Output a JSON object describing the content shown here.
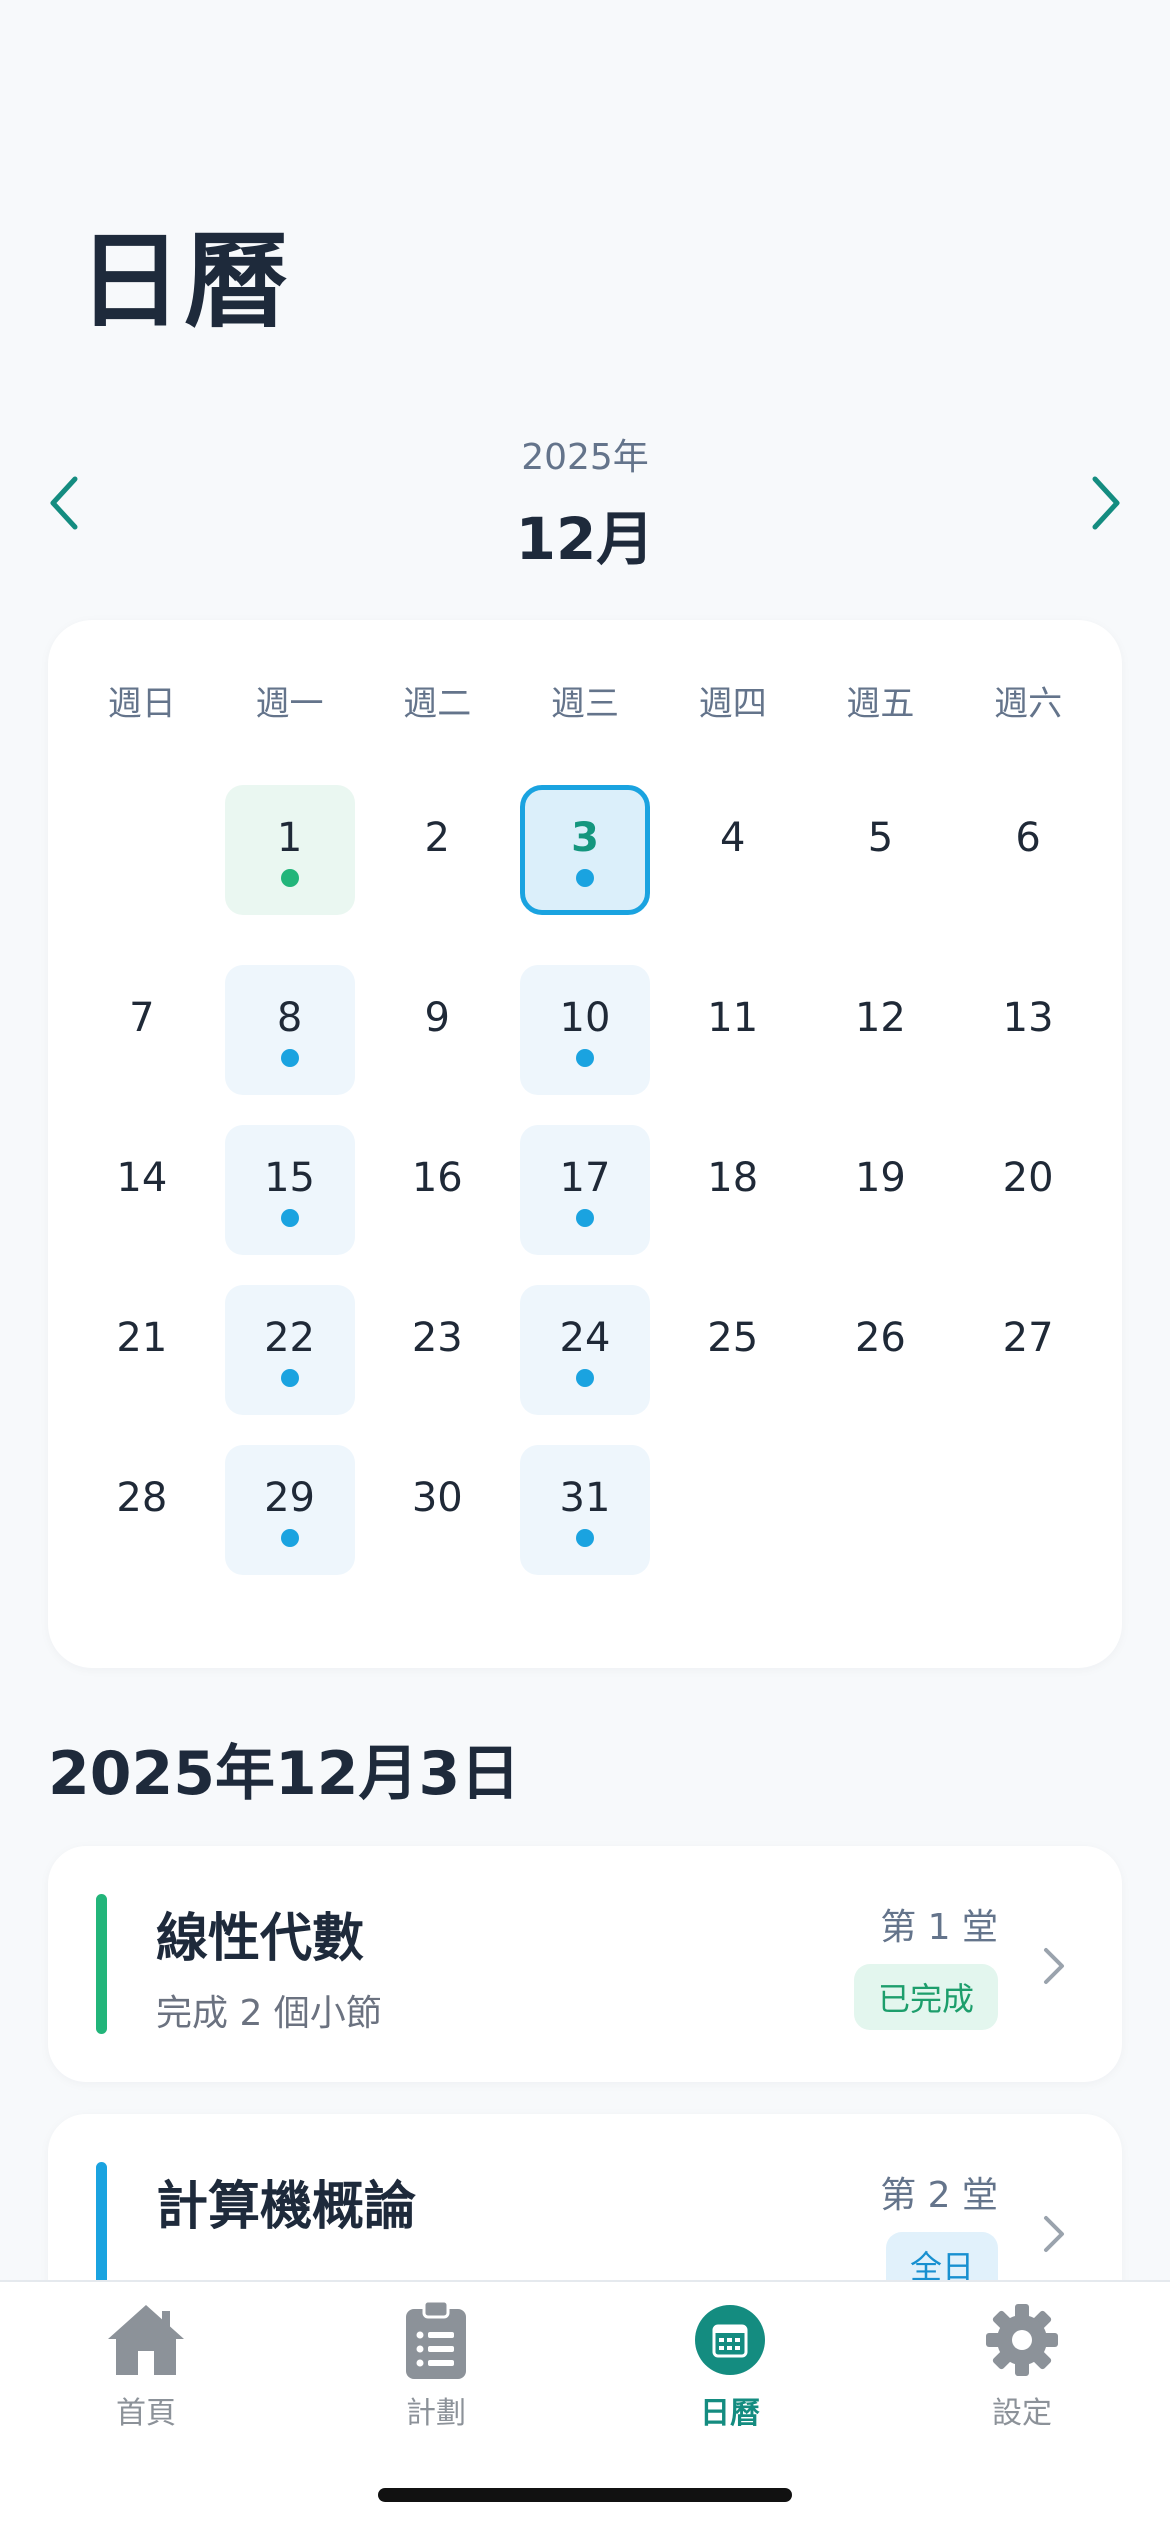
{
  "page_title": "日曆",
  "month_nav": {
    "year": "2025年",
    "month": "12月"
  },
  "weekdays": [
    "週日",
    "週一",
    "週二",
    "週三",
    "週四",
    "週五",
    "週六"
  ],
  "calendar": {
    "weeks": [
      [
        "",
        "1",
        "2",
        "3",
        "4",
        "5",
        "6"
      ],
      [
        "7",
        "8",
        "9",
        "10",
        "11",
        "12",
        "13"
      ],
      [
        "14",
        "15",
        "16",
        "17",
        "18",
        "19",
        "20"
      ],
      [
        "21",
        "22",
        "23",
        "24",
        "25",
        "26",
        "27"
      ],
      [
        "28",
        "29",
        "30",
        "31",
        "",
        "",
        ""
      ]
    ],
    "selected_day": "3",
    "completed_days": [
      "1"
    ],
    "planned_days": [
      "3",
      "8",
      "10",
      "15",
      "17",
      "22",
      "24",
      "29",
      "31"
    ]
  },
  "selected_date_heading": "2025年12月3日",
  "courses": [
    {
      "title": "線性代數",
      "subtitle": "完成 2 個小節",
      "session": "第 1 堂",
      "badge": "已完成",
      "color": "#22b57a",
      "badge_type": "done"
    },
    {
      "title": "計算機概論",
      "subtitle": "",
      "session": "第 2 堂",
      "badge": "全日",
      "color": "#1aa3e0",
      "badge_type": "full"
    }
  ],
  "tabs": [
    {
      "label": "首頁",
      "icon": "home-icon"
    },
    {
      "label": "計劃",
      "icon": "clipboard-icon"
    },
    {
      "label": "日曆",
      "icon": "calendar-icon",
      "active": true
    },
    {
      "label": "設定",
      "icon": "gear-icon"
    }
  ],
  "colors": {
    "accent": "#148c80",
    "plan_blue": "#1aa3e0",
    "done_green": "#22b57a"
  }
}
